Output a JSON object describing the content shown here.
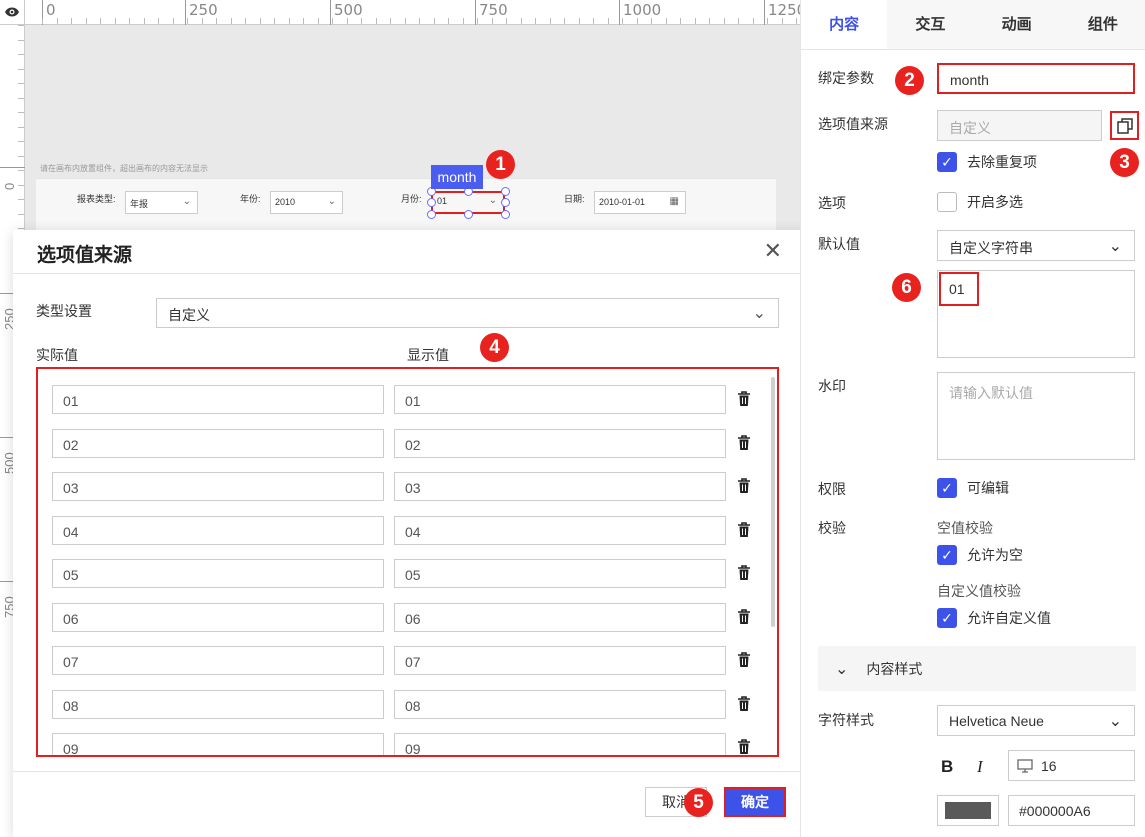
{
  "ruler": {
    "top_labels": [
      "0",
      "250",
      "500",
      "750",
      "1000",
      "1250"
    ],
    "left_labels": [
      "0",
      "250",
      "500",
      "750"
    ]
  },
  "canvas": {
    "tip": "请在画布内放置组件，超出画布的内容无法显示",
    "widget_tag": "month",
    "params": {
      "report_type_label": "报表类型:",
      "report_type_value": "年报",
      "year_label": "年份:",
      "year_value": "2010",
      "month_label": "月份:",
      "month_value": "01",
      "date_label": "日期:",
      "date_value": "2010-01-01"
    }
  },
  "badges": [
    "1",
    "2",
    "3",
    "4",
    "5",
    "6"
  ],
  "modal": {
    "title": "选项值来源",
    "type_label": "类型设置",
    "type_value": "自定义",
    "col_actual": "实际值",
    "col_display": "显示值",
    "rows": [
      {
        "actual": "01",
        "display": "01"
      },
      {
        "actual": "02",
        "display": "02"
      },
      {
        "actual": "03",
        "display": "03"
      },
      {
        "actual": "04",
        "display": "04"
      },
      {
        "actual": "05",
        "display": "05"
      },
      {
        "actual": "06",
        "display": "06"
      },
      {
        "actual": "07",
        "display": "07"
      },
      {
        "actual": "08",
        "display": "08"
      },
      {
        "actual": "09",
        "display": "09"
      }
    ],
    "cancel": "取消",
    "ok": "确定"
  },
  "panel": {
    "tabs": [
      "内容",
      "交互",
      "动画",
      "组件"
    ],
    "bind_param_label": "绑定参数",
    "bind_param_value": "month",
    "option_source_label": "选项值来源",
    "option_source_value": "自定义",
    "dedupe_label": "去除重复项",
    "options_label": "选项",
    "multi_label": "开启多选",
    "default_label": "默认值",
    "default_type": "自定义字符串",
    "default_value": "01",
    "watermark_label": "水印",
    "watermark_placeholder": "请输入默认值",
    "permission_label": "权限",
    "editable_label": "可编辑",
    "validation_label": "校验",
    "null_check_label": "空值校验",
    "allow_null_label": "允许为空",
    "custom_check_label": "自定义值校验",
    "allow_custom_label": "允许自定义值",
    "section_content_style": "内容样式",
    "char_style_label": "字符样式",
    "font_value": "Helvetica Neue",
    "bold": "B",
    "italic": "I",
    "font_size": "16",
    "color_hex": "#000000A6"
  },
  "colors": {
    "accent": "#3d52e8",
    "highlight_red": "#e02020",
    "font_color_swatch": "#595959"
  }
}
